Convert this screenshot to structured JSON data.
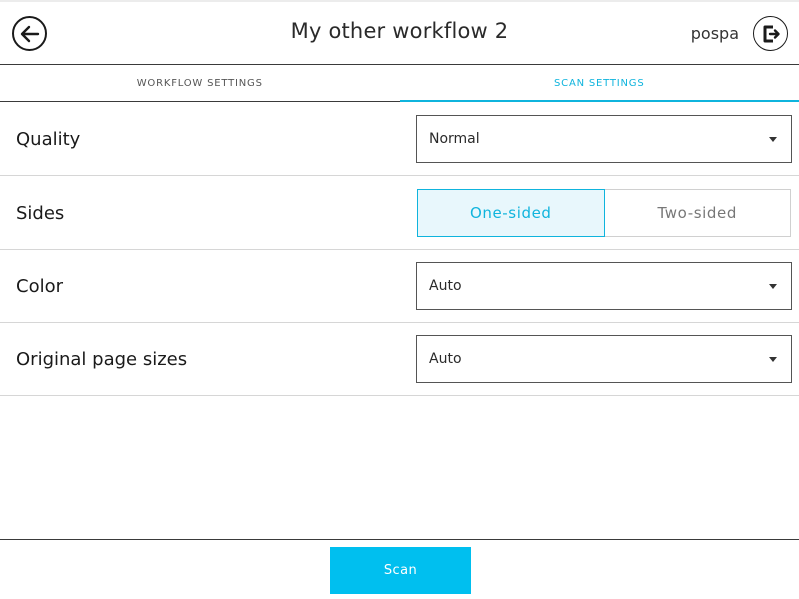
{
  "header": {
    "title": "My other workflow 2",
    "username": "pospa",
    "back_icon": "arrow-left-icon",
    "logout_icon": "logout-icon"
  },
  "tabs": [
    {
      "label": "WORKFLOW SETTINGS",
      "active": false
    },
    {
      "label": "SCAN SETTINGS",
      "active": true
    }
  ],
  "settings": {
    "quality": {
      "label": "Quality",
      "value": "Normal"
    },
    "sides": {
      "label": "Sides",
      "options": [
        "One-sided",
        "Two-sided"
      ],
      "selected": "One-sided"
    },
    "color": {
      "label": "Color",
      "value": "Auto"
    },
    "page_sizes": {
      "label": "Original page sizes",
      "value": "Auto"
    }
  },
  "footer": {
    "scan_label": "Scan"
  },
  "colors": {
    "accent": "#0fb4dd",
    "button": "#00bfef"
  }
}
